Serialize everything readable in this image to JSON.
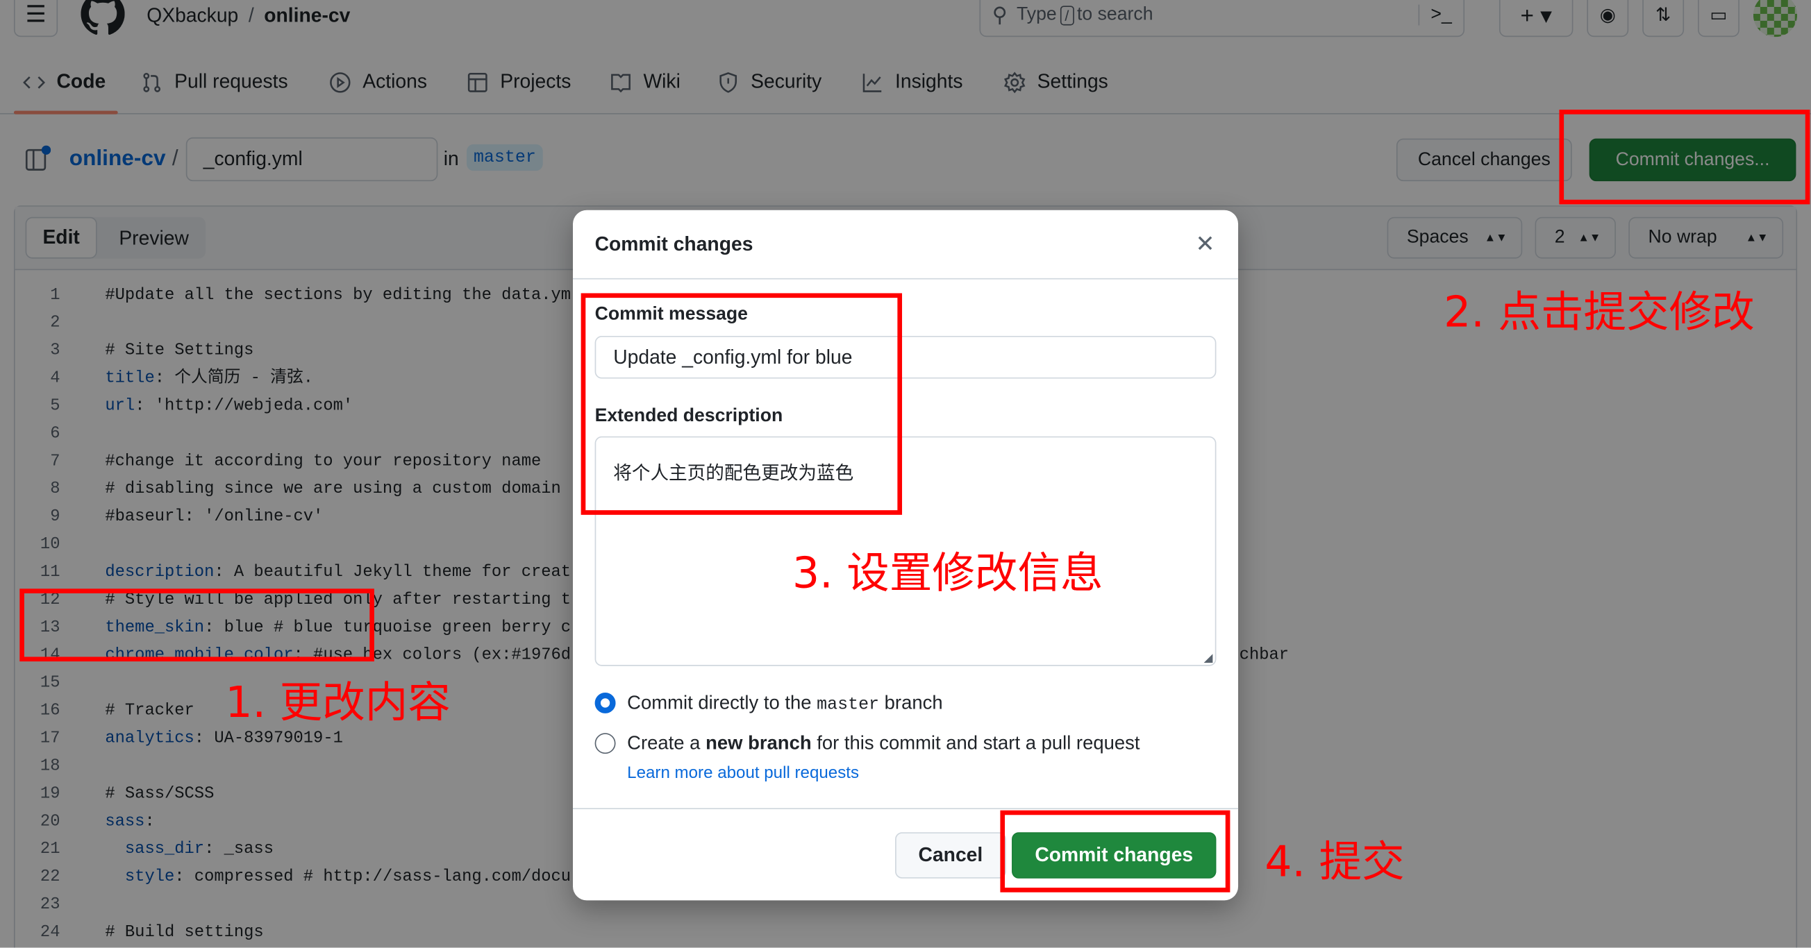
{
  "header": {
    "owner": "QXbackup",
    "separator": "/",
    "repo": "online-cv",
    "search_placeholder_pre": "Type",
    "search_key": "/",
    "search_placeholder_post": "to search"
  },
  "nav": [
    {
      "label": "Code",
      "icon": "code-icon",
      "active": true
    },
    {
      "label": "Pull requests",
      "icon": "git-pull-request-icon"
    },
    {
      "label": "Actions",
      "icon": "play-icon"
    },
    {
      "label": "Projects",
      "icon": "table-icon"
    },
    {
      "label": "Wiki",
      "icon": "book-icon"
    },
    {
      "label": "Security",
      "icon": "shield-icon"
    },
    {
      "label": "Insights",
      "icon": "graph-icon"
    },
    {
      "label": "Settings",
      "icon": "gear-icon"
    }
  ],
  "file": {
    "repo_link": "online-cv",
    "slash": "/",
    "filename": "_config.yml",
    "in": "in",
    "branch": "master",
    "cancel_label": "Cancel changes",
    "commit_label": "Commit changes..."
  },
  "editor": {
    "tabs": [
      "Edit",
      "Preview"
    ],
    "indent_mode": "Spaces",
    "indent_size": "2",
    "wrap_mode": "No wrap",
    "overflow_fragment": "chbar",
    "lines": [
      {
        "n": "1",
        "key": "",
        "text": "#Update all the sections by editing the data.ym"
      },
      {
        "n": "2",
        "key": "",
        "text": ""
      },
      {
        "n": "3",
        "key": "",
        "text": "# Site Settings"
      },
      {
        "n": "4",
        "key": "title",
        "text": ": 个人简历 - 清弦."
      },
      {
        "n": "5",
        "key": "url",
        "text": ": 'http://webjeda.com'"
      },
      {
        "n": "6",
        "key": "",
        "text": ""
      },
      {
        "n": "7",
        "key": "",
        "text": "#change it according to your repository name"
      },
      {
        "n": "8",
        "key": "",
        "text": "# disabling since we are using a custom domain"
      },
      {
        "n": "9",
        "key": "",
        "text": "#baseurl: '/online-cv'"
      },
      {
        "n": "10",
        "key": "",
        "text": ""
      },
      {
        "n": "11",
        "key": "description",
        "text": ": A beautiful Jekyll theme for creat"
      },
      {
        "n": "12",
        "key": "",
        "text": "# Style will be applied only after restarting t"
      },
      {
        "n": "13",
        "key": "theme_skin",
        "text": ": blue # blue turquoise green berry c"
      },
      {
        "n": "14",
        "key": "chrome_mobile_color",
        "text": ": #use hex colors (ex:#1976d"
      },
      {
        "n": "15",
        "key": "",
        "text": ""
      },
      {
        "n": "16",
        "key": "",
        "text": "# Tracker"
      },
      {
        "n": "17",
        "key": "analytics",
        "text": ": UA-83979019-1"
      },
      {
        "n": "18",
        "key": "",
        "text": ""
      },
      {
        "n": "19",
        "key": "",
        "text": "# Sass/SCSS"
      },
      {
        "n": "20",
        "key": "sass",
        "text": ":"
      },
      {
        "n": "21",
        "key": "  sass_dir",
        "text": ": _sass"
      },
      {
        "n": "22",
        "key": "  style",
        "text": ": compressed # http://sass-lang.com/docu"
      },
      {
        "n": "23",
        "key": "",
        "text": ""
      },
      {
        "n": "24",
        "key": "",
        "text": "# Build settings"
      }
    ]
  },
  "modal": {
    "title": "Commit changes",
    "message_label": "Commit message",
    "message_value": "Update _config.yml for blue",
    "description_label": "Extended description",
    "description_value": "将个人主页的配色更改为蓝色",
    "option_direct_pre": "Commit directly to the",
    "option_direct_branch": "master",
    "option_direct_post": "branch",
    "option_new_pre": "Create a",
    "option_new_bold": "new branch",
    "option_new_post": "for this commit and start a pull request",
    "learn_more": "Learn more about pull requests",
    "selected_option": "direct",
    "cancel_label": "Cancel",
    "commit_label": "Commit changes"
  },
  "annotations": {
    "step1": "1. 更改内容",
    "step2": "2. 点击提交修改",
    "step3": "3. 设置修改信息",
    "step4": "4. 提交",
    "color": "#ff0000"
  },
  "colors": {
    "primary_green": "#1f883d",
    "link_blue": "#0969da",
    "active_tab": "#fd8c73"
  }
}
